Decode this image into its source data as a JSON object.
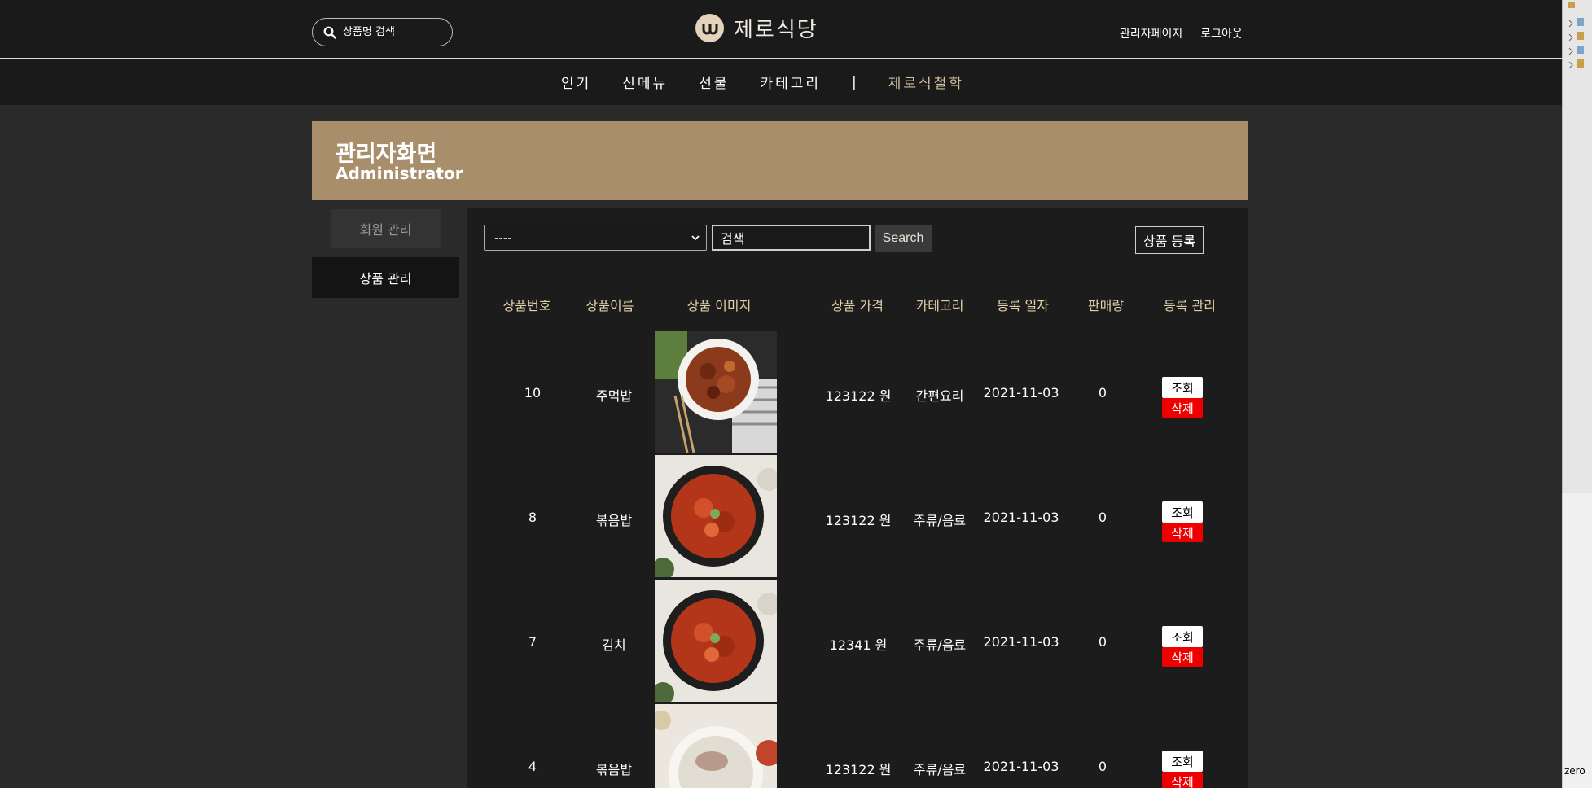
{
  "header": {
    "search_placeholder": "상품명 검색",
    "logo_text": "제로식당",
    "links": [
      "관리자페이지",
      "로그아웃"
    ]
  },
  "nav": {
    "items": [
      "인기",
      "신메뉴",
      "선물",
      "카테고리"
    ],
    "divider": "|",
    "philosophy": "제로식철학"
  },
  "banner": {
    "title": "관리자화면",
    "subtitle": "Administrator"
  },
  "sidebar": {
    "member": "회원 관리",
    "product": "상품 관리"
  },
  "toolbar": {
    "select_value": "----",
    "keyword_value": "검색",
    "search_label": "Search",
    "register_label": "상품 등록"
  },
  "table": {
    "headers": [
      "상품번호",
      "상품이름",
      "상품 이미지",
      "상품 가격",
      "카테고리",
      "등록 일자",
      "판매량",
      "등록 관리"
    ],
    "rows": [
      {
        "id": "10",
        "name": "주먹밥",
        "image": "spicy-pork-bowl",
        "price": "123122 원",
        "category": "간편요리",
        "date": "2021-11-03",
        "sales": "0"
      },
      {
        "id": "8",
        "name": "볶음밥",
        "image": "kimchi-stew-pot",
        "price": "123122 원",
        "category": "주류/음료",
        "date": "2021-11-03",
        "sales": "0"
      },
      {
        "id": "7",
        "name": "김치",
        "image": "kimchi-stew-pot",
        "price": "12341 원",
        "category": "주류/음료",
        "date": "2021-11-03",
        "sales": "0"
      },
      {
        "id": "4",
        "name": "볶음밥",
        "image": "beef-soup-bowl",
        "price": "123122 원",
        "category": "주류/음료",
        "date": "2021-11-03",
        "sales": "0"
      }
    ],
    "view_label": "조회",
    "delete_label": "삭제"
  },
  "status": {
    "corner_text": "zero"
  },
  "colors": {
    "banner": "#a98e6c",
    "header_bg": "#1a1a1a",
    "page_bg": "#2a2a2a",
    "accent_text": "#e3cfa9",
    "delete_red": "#e00000"
  }
}
